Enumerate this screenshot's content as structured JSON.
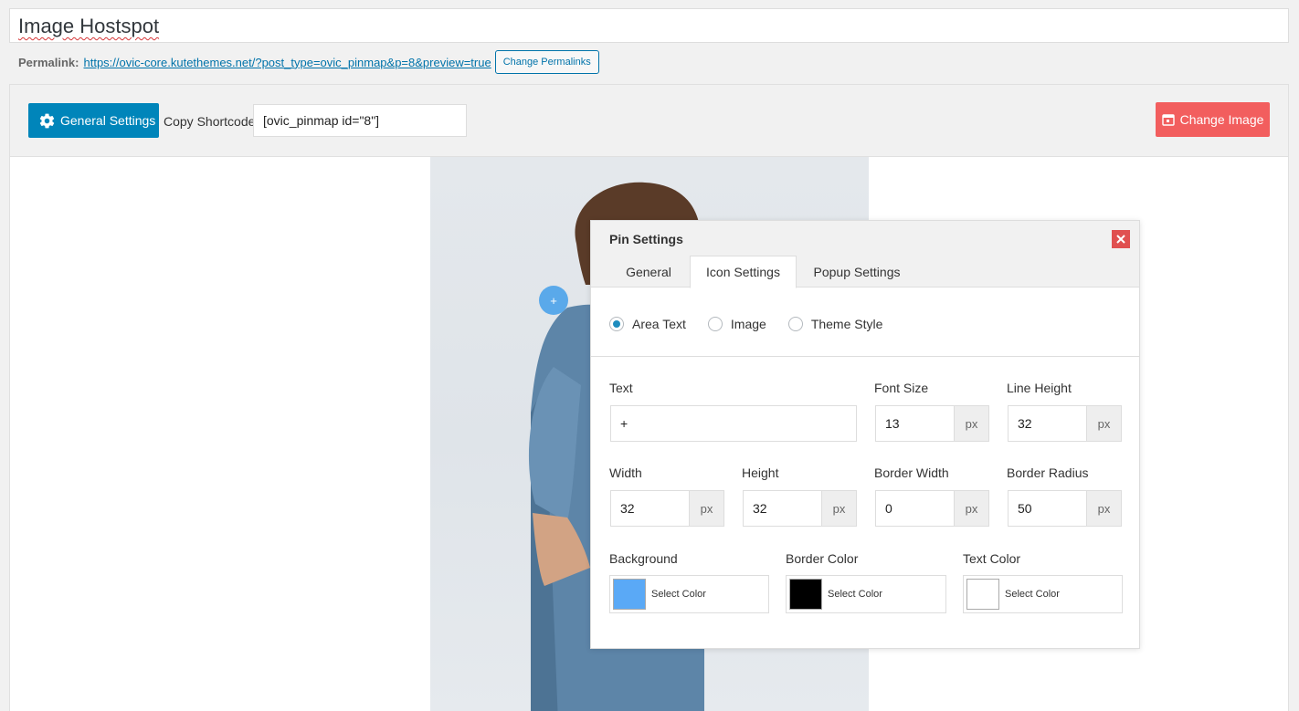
{
  "post": {
    "title": "Image Hostspot",
    "permalink_label": "Permalink:",
    "permalink_url": "https://ovic-core.kutethemes.net/?post_type=ovic_pinmap&p=8&preview=true",
    "change_permalinks_label": "Change Permalinks"
  },
  "toolbar": {
    "general_settings_label": "General Settings",
    "copy_shortcode_label": "Copy Shortcode",
    "shortcode_value": "[ovic_pinmap id=\"8\"]",
    "change_image_label": "Change Image",
    "change_image_color": "#f25e5e",
    "general_settings_color": "#0085ba"
  },
  "hotspot": {
    "text": "+",
    "color": "#5aa9ea"
  },
  "dialog": {
    "title": "Pin Settings",
    "tabs": [
      {
        "label": "General",
        "active": false
      },
      {
        "label": "Icon Settings",
        "active": true
      },
      {
        "label": "Popup Settings",
        "active": false
      }
    ],
    "icon_types": [
      {
        "label": "Area Text",
        "selected": true
      },
      {
        "label": "Image",
        "selected": false
      },
      {
        "label": "Theme Style",
        "selected": false
      }
    ],
    "fields": {
      "text": {
        "label": "Text",
        "value": "+"
      },
      "font_size": {
        "label": "Font Size",
        "value": "13",
        "unit": "px"
      },
      "line_height": {
        "label": "Line Height",
        "value": "32",
        "unit": "px"
      },
      "width": {
        "label": "Width",
        "value": "32",
        "unit": "px"
      },
      "height": {
        "label": "Height",
        "value": "32",
        "unit": "px"
      },
      "border_width": {
        "label": "Border Width",
        "value": "0",
        "unit": "px"
      },
      "border_radius": {
        "label": "Border Radius",
        "value": "50",
        "unit": "px"
      }
    },
    "colors": [
      {
        "label": "Background",
        "button": "Select Color",
        "value": "#5aa9f6"
      },
      {
        "label": "Border Color",
        "button": "Select Color",
        "value": "#000000"
      },
      {
        "label": "Text Color",
        "button": "Select Color",
        "value": "#ffffff"
      }
    ]
  }
}
